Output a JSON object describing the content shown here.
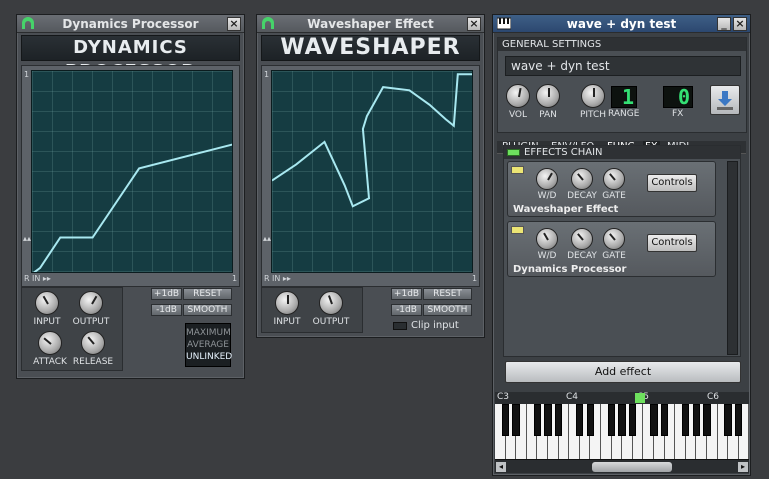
{
  "dynamics": {
    "title": "Dynamics Processor",
    "banner": "DYNAMICS PROCESSOR",
    "close": "×",
    "axis_top": "1",
    "axis_bottom_right": "1",
    "axis_r": "R",
    "axis_in": "IN ▸▸",
    "axis_arrows": "▴▴",
    "btn_plus": "+1dB",
    "btn_minus": "-1dB",
    "btn_reset": "RESET",
    "btn_smooth": "SMOOTH",
    "knob_input": "INPUT",
    "knob_output": "OUTPUT",
    "knob_attack": "ATTACK",
    "knob_release": "RELEASE",
    "stereo_mode_1": "MAXIMUM",
    "stereo_mode_2": "AVERAGE",
    "stereo_mode_3": "UNLINKED",
    "curve": [
      [
        0.0,
        0.0
      ],
      [
        0.04,
        0.03
      ],
      [
        0.14,
        0.18
      ],
      [
        0.3,
        0.18
      ],
      [
        0.53,
        0.52
      ],
      [
        1.0,
        0.64
      ]
    ]
  },
  "waveshaper": {
    "title": "Waveshaper Effect",
    "banner": "WAVESHAPER",
    "close": "×",
    "axis_top": "1",
    "axis_bottom_right": "1",
    "axis_r": "R",
    "axis_in": "IN ▸▸",
    "axis_arrows": "▴▴",
    "btn_plus": "+1dB",
    "btn_minus": "-1dB",
    "btn_reset": "RESET",
    "btn_smooth": "SMOOTH",
    "knob_input": "INPUT",
    "knob_output": "OUTPUT",
    "clip_input": "Clip input",
    "curve": [
      [
        0.0,
        0.58
      ],
      [
        0.12,
        0.68
      ],
      [
        0.26,
        0.82
      ],
      [
        0.36,
        0.55
      ],
      [
        0.4,
        0.42
      ],
      [
        0.48,
        0.47
      ],
      [
        0.45,
        0.9
      ],
      [
        0.47,
        0.98
      ],
      [
        0.55,
        1.16
      ],
      [
        0.68,
        1.14
      ],
      [
        0.78,
        1.05
      ],
      [
        0.86,
        0.96
      ],
      [
        0.9,
        0.92
      ],
      [
        0.92,
        1.24
      ],
      [
        1.0,
        1.24
      ]
    ]
  },
  "instrument": {
    "title": "wave + dyn test",
    "general_settings": "GENERAL SETTINGS",
    "name_value": "wave + dyn test",
    "vol": "VOL",
    "pan": "PAN",
    "pitch": "PITCH",
    "range": "RANGE",
    "range_value": "1",
    "fx": "FX",
    "fx_value": "0",
    "tabs": [
      "PLUGIN",
      "ENV/LFO",
      "FUNC",
      "FX",
      "MIDI"
    ],
    "effects_chain": "EFFECTS CHAIN",
    "effects": [
      {
        "name": "Waveshaper Effect",
        "wd": "W/D",
        "decay": "DECAY",
        "gate": "GATE",
        "controls": "Controls"
      },
      {
        "name": "Dynamics Processor",
        "wd": "W/D",
        "decay": "DECAY",
        "gate": "GATE",
        "controls": "Controls"
      }
    ],
    "add_effect": "Add effect",
    "octaves": [
      "C3",
      "C4",
      "C5",
      "C6"
    ],
    "minimize": "_",
    "close": "×"
  },
  "colors": {
    "graph_bg": "#153c42",
    "curve": "#a8e8f0",
    "lcd_green": "#34e074",
    "accent_led": "#6ee05e"
  }
}
